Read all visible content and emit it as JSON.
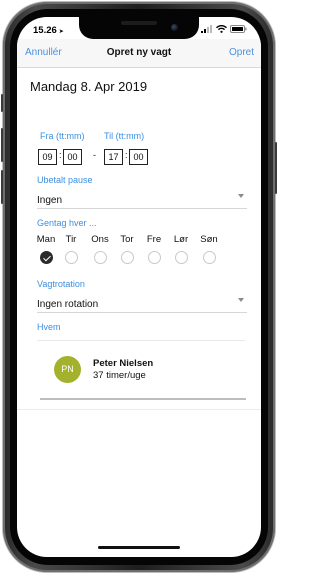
{
  "status_bar": {
    "time": "15.26",
    "location_arrow": "➤",
    "icons": [
      "signal-icon",
      "wifi-icon",
      "battery-icon"
    ]
  },
  "nav": {
    "cancel_label": "Annullér",
    "title": "Opret ny vagt",
    "create_label": "Opret"
  },
  "shift": {
    "date": "Mandag 8. Apr 2019",
    "from_label": "Fra (tt:mm)",
    "to_label": "Til (tt:mm)",
    "from_hour": "09",
    "from_min": "00",
    "to_hour": "17",
    "to_min": "00",
    "time_colon": ":",
    "time_dash": "-"
  },
  "pause": {
    "label": "Ubetalt pause",
    "value": "Ingen"
  },
  "repeat": {
    "label": "Gentag hver ...",
    "days": [
      {
        "label": "Man",
        "checked": true
      },
      {
        "label": "Tir",
        "checked": false
      },
      {
        "label": "Ons",
        "checked": false
      },
      {
        "label": "Tor",
        "checked": false
      },
      {
        "label": "Fre",
        "checked": false
      },
      {
        "label": "Lør",
        "checked": false
      },
      {
        "label": "Søn",
        "checked": false
      }
    ]
  },
  "rotation": {
    "label": "Vagtrotation",
    "value": "Ingen rotation"
  },
  "who": {
    "label": "Hvem",
    "person": {
      "initials": "PN",
      "name": "Peter Nielsen",
      "hours": "37 timer/uge",
      "avatar_color": "#a3b12c"
    }
  },
  "colors": {
    "accent": "#3d8fe0",
    "nav_bg": "#f7f7f7"
  }
}
